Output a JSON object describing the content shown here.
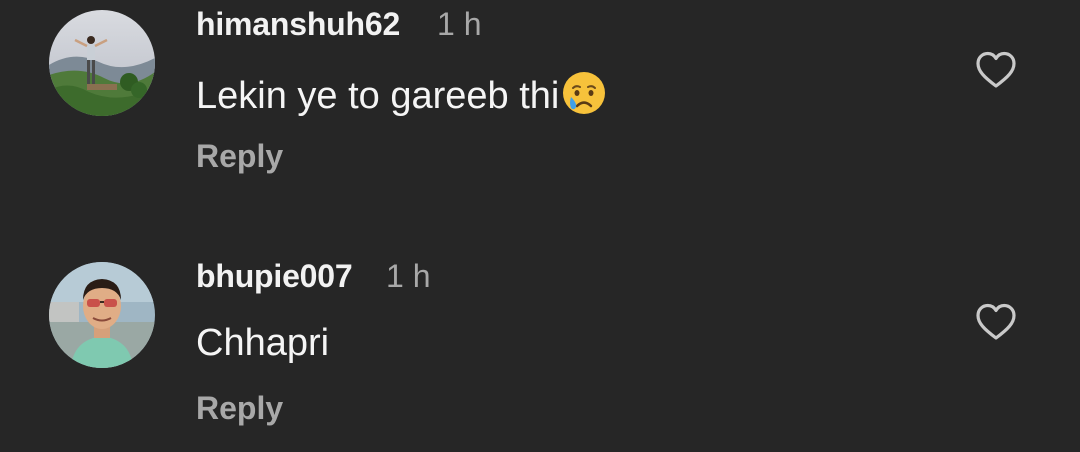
{
  "comments": [
    {
      "username": "himanshuh62",
      "time": "1 h",
      "text": "Lekin ye to gareeb thi",
      "emoji": "crying-face",
      "reply_label": "Reply",
      "avatar": "landscape-person-avatar",
      "like_icon": "heart-outline-icon"
    },
    {
      "username": "bhupie007",
      "time": "1 h",
      "text": "Chhapri",
      "reply_label": "Reply",
      "avatar": "man-sunglasses-avatar",
      "like_icon": "heart-outline-icon"
    }
  ],
  "colors": {
    "background": "#262626",
    "primary_text": "#f5f5f5",
    "secondary_text": "#a8a8a8"
  }
}
